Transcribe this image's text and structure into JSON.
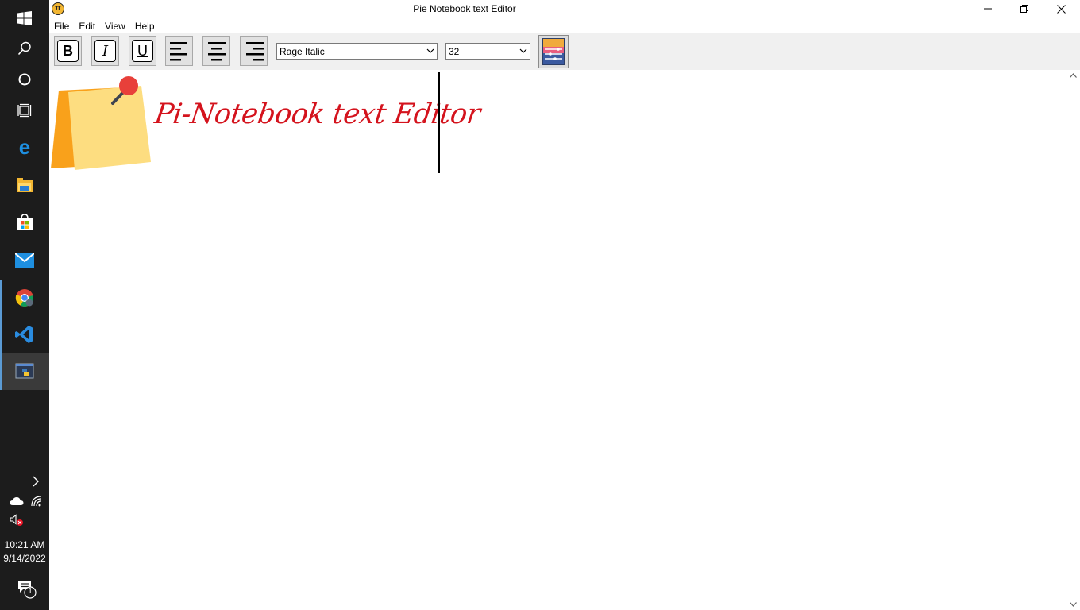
{
  "window": {
    "title": "Pie Notebook text Editor",
    "app_icon_glyph": "π"
  },
  "menu": {
    "items": [
      "File",
      "Edit",
      "View",
      "Help"
    ]
  },
  "toolbar": {
    "bold_label": "B",
    "italic_label": "I",
    "underline_label": "U",
    "font_family_value": "Rage Italic",
    "font_size_value": "32",
    "align_icons": [
      "align-left-icon",
      "align-center-icon",
      "align-right-icon"
    ],
    "color_button_icon": "color-palette-icon"
  },
  "editor": {
    "content": "Pi-Notebook text Editor",
    "text_color": "#d4131d",
    "image_icon": "sticky-note-pin-icon"
  },
  "taskbar": {
    "apps": [
      "windows-start-icon",
      "search-icon",
      "cortana-icon",
      "task-view-icon",
      "edge-icon",
      "file-explorer-icon",
      "store-icon",
      "mail-icon",
      "chrome-icon",
      "vscode-icon",
      "python-app-icon"
    ],
    "clock_time": "10:21 AM",
    "clock_date": "9/14/2022",
    "notification_count": "1"
  }
}
